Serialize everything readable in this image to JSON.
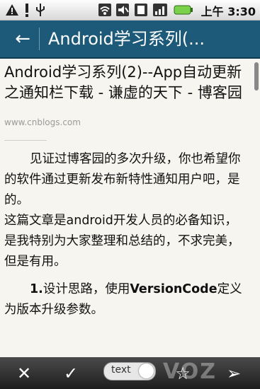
{
  "status_bar": {
    "time": "上午 3:30",
    "icons": [
      "warning-icon",
      "usb-icon",
      "wifi-icon",
      "mute-icon",
      "sim-icon",
      "signal-icon",
      "battery-icon"
    ]
  },
  "header": {
    "title": "Android学习系列(..."
  },
  "article": {
    "title": "Android学习系列(2)--App自动更新之通知栏下载 - 谦虚的天下 - 博客园",
    "source": "www.cnblogs.com",
    "paragraphs": [
      "见证过博客园的多次升级，你也希望你的软件通过更新发布新特性通知用户吧，是的。",
      "这篇文章是android开发人员的必备知识，是我特别为大家整理和总结的，不求完美，但是有用。"
    ],
    "section_number": "1.",
    "section_text_1": "设计思路，使用",
    "section_bold": "VersionCode",
    "section_text_2": "定义为版本升级参数。"
  },
  "bottom_bar": {
    "toggle_label": "text",
    "watermark": "VOZ"
  },
  "colors": {
    "titlebar": "#1d5a7a",
    "background": "#f7f5ef",
    "bottombar": "#2a2a2a"
  }
}
